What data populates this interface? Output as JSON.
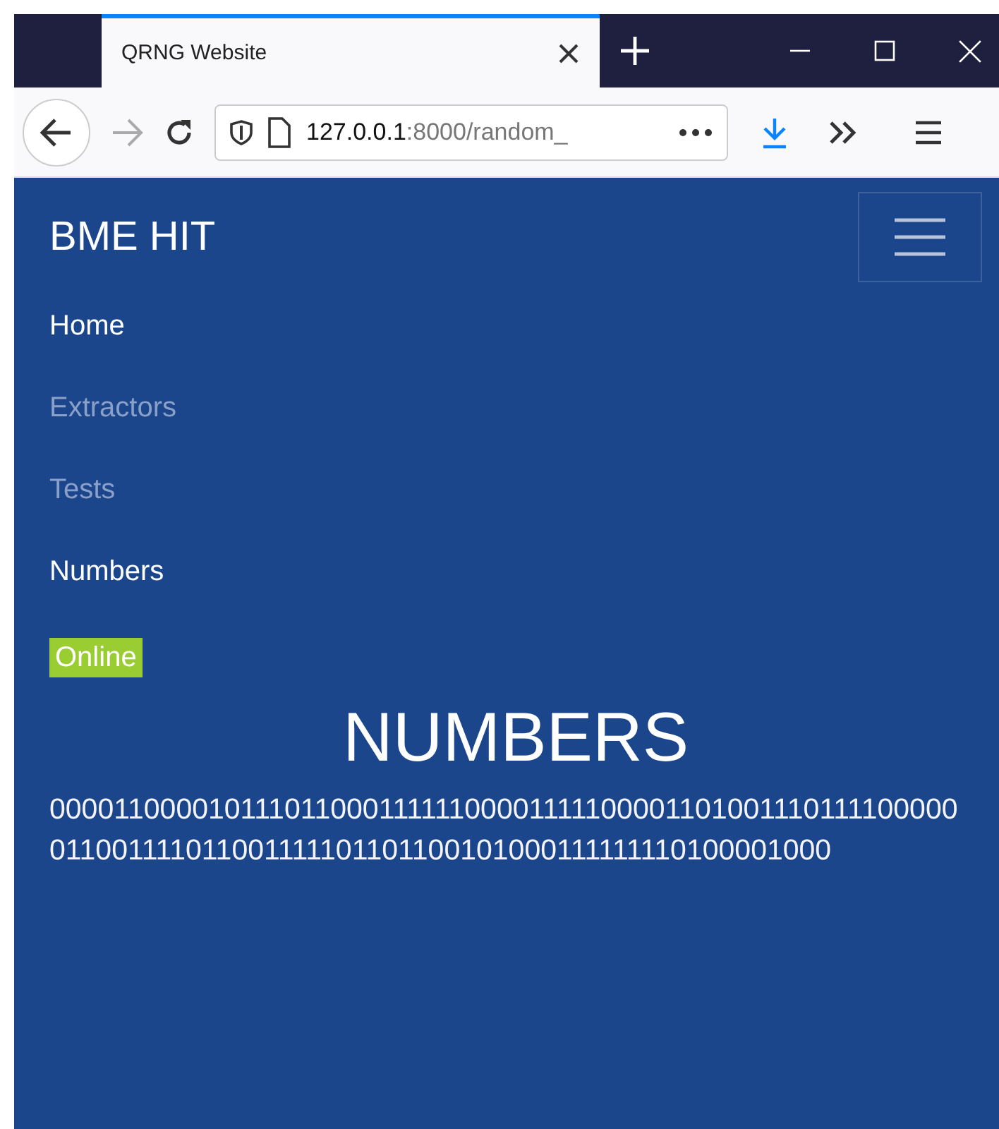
{
  "browser": {
    "tab": {
      "title": "QRNG Website",
      "selected": true
    },
    "address": {
      "host": "127.0.0.1",
      "rest": ":8000/random_"
    }
  },
  "navbar": {
    "brand": "BME HIT",
    "items": [
      {
        "label": "Home",
        "disabled": false
      },
      {
        "label": "Extractors",
        "disabled": true
      },
      {
        "label": "Tests",
        "disabled": true
      },
      {
        "label": "Numbers",
        "disabled": false
      }
    ],
    "status": {
      "label": "Online",
      "color": "#9acd32"
    }
  },
  "content": {
    "heading": "NUMBERS",
    "numbers": "00001100001011101100011111100001111100001101001110111100000011001111011001111101101100101000111111110100001000"
  }
}
